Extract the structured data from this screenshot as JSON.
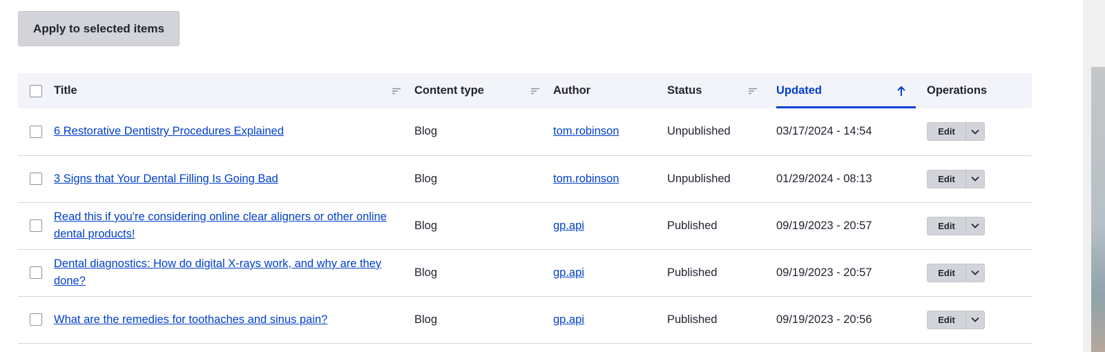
{
  "bulk": {
    "apply_label": "Apply to selected items"
  },
  "table": {
    "headers": {
      "title": "Title",
      "content_type": "Content type",
      "author": "Author",
      "status": "Status",
      "updated": "Updated",
      "operations": "Operations"
    },
    "sort": {
      "active_column": "Updated",
      "direction": "ascending"
    },
    "rows": [
      {
        "title": "6 Restorative Dentistry Procedures Explained",
        "type": "Blog",
        "author": "tom.robinson",
        "status": "Unpublished",
        "updated": "03/17/2024 - 14:54",
        "edit": "Edit"
      },
      {
        "title": "3 Signs that Your Dental Filling Is Going Bad",
        "type": "Blog",
        "author": "tom.robinson",
        "status": "Unpublished",
        "updated": "01/29/2024 - 08:13",
        "edit": "Edit"
      },
      {
        "title": "Read this if you're considering online clear aligners or other online dental products!",
        "type": "Blog",
        "author": "gp.api",
        "status": "Published",
        "updated": "09/19/2023 - 20:57",
        "edit": "Edit"
      },
      {
        "title": "Dental diagnostics: How do digital X-rays work, and why are they done?",
        "type": "Blog",
        "author": "gp.api",
        "status": "Published",
        "updated": "09/19/2023 - 20:57",
        "edit": "Edit"
      },
      {
        "title": "What are the remedies for toothaches and sinus pain?",
        "type": "Blog",
        "author": "gp.api",
        "status": "Published",
        "updated": "09/19/2023 - 20:56",
        "edit": "Edit"
      }
    ]
  },
  "colors": {
    "link": "#003ecc",
    "button_bg": "#d3d4d9",
    "header_bg": "#f3f4f9"
  },
  "icons": {
    "sort": "sort-lines-icon",
    "sort_active": "arrow-up-icon",
    "dropdown": "chevron-down-icon"
  }
}
